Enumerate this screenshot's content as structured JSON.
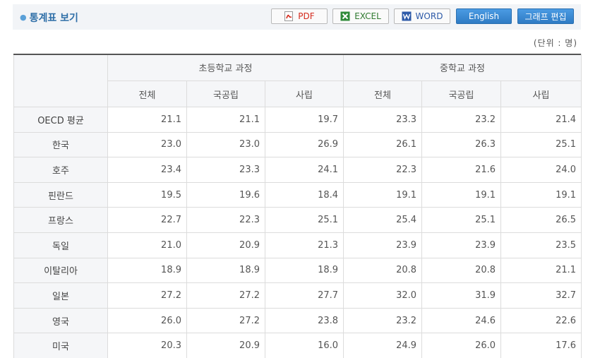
{
  "title": "통계표 보기",
  "buttons": {
    "pdf": "PDF",
    "excel": "EXCEL",
    "word": "WORD",
    "english": "English",
    "graph_edit": "그래프 편집"
  },
  "unit": "(단위 : 명)",
  "table": {
    "groups": [
      "초등학교 과정",
      "중학교 과정"
    ],
    "subheaders": [
      "전체",
      "국공립",
      "사립",
      "전체",
      "국공립",
      "사립"
    ],
    "rows": [
      {
        "country": "OECD 평균",
        "values": [
          "21.1",
          "21.1",
          "19.7",
          "23.3",
          "23.2",
          "21.4"
        ]
      },
      {
        "country": "한국",
        "values": [
          "23.0",
          "23.0",
          "26.9",
          "26.1",
          "26.3",
          "25.1"
        ]
      },
      {
        "country": "호주",
        "values": [
          "23.4",
          "23.3",
          "24.1",
          "22.3",
          "21.6",
          "24.0"
        ]
      },
      {
        "country": "핀란드",
        "values": [
          "19.5",
          "19.6",
          "18.4",
          "19.1",
          "19.1",
          "19.1"
        ]
      },
      {
        "country": "프랑스",
        "values": [
          "22.7",
          "22.3",
          "25.1",
          "25.4",
          "25.1",
          "26.5"
        ]
      },
      {
        "country": "독일",
        "values": [
          "21.0",
          "20.9",
          "21.3",
          "23.9",
          "23.9",
          "23.5"
        ]
      },
      {
        "country": "이탈리아",
        "values": [
          "18.9",
          "18.9",
          "18.9",
          "20.8",
          "20.8",
          "21.1"
        ]
      },
      {
        "country": "일본",
        "values": [
          "27.2",
          "27.2",
          "27.7",
          "32.0",
          "31.9",
          "32.7"
        ]
      },
      {
        "country": "영국",
        "values": [
          "26.0",
          "27.2",
          "23.8",
          "23.2",
          "24.6",
          "22.6"
        ]
      },
      {
        "country": "미국",
        "values": [
          "20.3",
          "20.9",
          "16.0",
          "24.9",
          "26.0",
          "17.6"
        ]
      }
    ]
  }
}
